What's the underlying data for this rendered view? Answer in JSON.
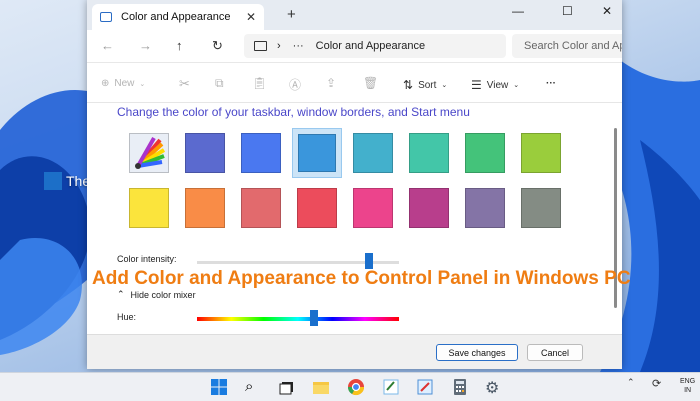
{
  "window": {
    "tab_title": "Color and Appearance",
    "tab_close": "✕",
    "new_tab": "+",
    "controls": {
      "minimize": "—",
      "maximize": "☐",
      "close": "✕"
    }
  },
  "address_bar": {
    "breadcrumb_separator": "›",
    "breadcrumb_ellipsis": "···",
    "location": "Color and Appearance",
    "search_placeholder": "Search Color and Ap"
  },
  "command_bar": {
    "new_label": "New",
    "sort_label": "Sort",
    "view_label": "View",
    "more_label": "···"
  },
  "watermark": "TheWindowsClub",
  "content": {
    "heading": "Change the color of your taskbar, window borders, and Start menu",
    "swatches": [
      {
        "name": "automatic",
        "color": "auto"
      },
      {
        "name": "slate-blue",
        "color": "#5b6acf"
      },
      {
        "name": "royal-blue",
        "color": "#4a78f0"
      },
      {
        "name": "sky-blue",
        "color": "#3a96dc",
        "selected": true
      },
      {
        "name": "teal-blue",
        "color": "#43b0cc"
      },
      {
        "name": "turquoise",
        "color": "#43c6a8"
      },
      {
        "name": "green",
        "color": "#44c37a"
      },
      {
        "name": "lime",
        "color": "#9acd3c"
      },
      {
        "name": "yellow",
        "color": "#fbe43c"
      },
      {
        "name": "orange",
        "color": "#f98c47"
      },
      {
        "name": "salmon",
        "color": "#e26a6d"
      },
      {
        "name": "red",
        "color": "#ec4c5c"
      },
      {
        "name": "pink",
        "color": "#ec448c"
      },
      {
        "name": "magenta",
        "color": "#b83e8c"
      },
      {
        "name": "purple-gray",
        "color": "#8474a6"
      },
      {
        "name": "gray-green",
        "color": "#848c84"
      }
    ],
    "intensity_label": "Color intensity:",
    "intensity_level": 0.85,
    "hide_mixer_label": "Hide color mixer",
    "hue_label": "Hue:",
    "hue_level": 0.58
  },
  "overlay_title": "Add Color and Appearance to Control Panel in Windows PC",
  "buttons": {
    "save": "Save changes",
    "cancel": "Cancel"
  },
  "tray": {
    "lang_line1": "ENG",
    "lang_line2": "IN"
  },
  "colors": {
    "accent": "#1a6fcc",
    "heading": "#4a47c9",
    "overlay": "#ef7d13"
  }
}
